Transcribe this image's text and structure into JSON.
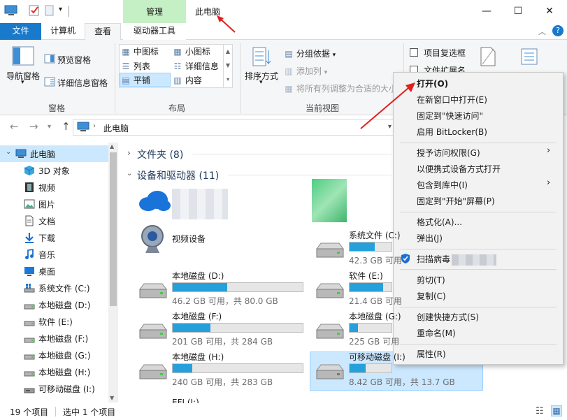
{
  "window": {
    "title": "此电脑",
    "context_tab": "管理",
    "controls": {
      "minimize": "—",
      "maximize": "☐",
      "close": "✕"
    }
  },
  "tabs": [
    {
      "label": "文件"
    },
    {
      "label": "计算机"
    },
    {
      "label": "查看"
    },
    {
      "label": "驱动器工具"
    }
  ],
  "ribbon": {
    "pane_group": {
      "label": "窗格",
      "nav_pane": "导航窗格",
      "preview_pane": "预览窗格",
      "details_pane": "详细信息窗格"
    },
    "layout_group": {
      "label": "布局",
      "items": [
        "中图标",
        "小图标",
        "列表",
        "详细信息",
        "平铺",
        "内容"
      ],
      "selected": "平铺"
    },
    "view_group": {
      "label": "当前视图",
      "sort": "排序方式",
      "group_by": "分组依据",
      "add_column": "添加列",
      "fit_columns": "将所有列调整为合适的大小"
    },
    "show_group": {
      "item_checkbox": "项目复选框",
      "file_ext": "文件扩展名"
    }
  },
  "address": {
    "path": "此电脑"
  },
  "nav": {
    "items": [
      {
        "label": "此电脑",
        "icon": "pc-icon"
      },
      {
        "label": "3D 对象",
        "icon": "cube-icon"
      },
      {
        "label": "视频",
        "icon": "film-icon"
      },
      {
        "label": "图片",
        "icon": "image-icon"
      },
      {
        "label": "文档",
        "icon": "document-icon"
      },
      {
        "label": "下载",
        "icon": "download-icon"
      },
      {
        "label": "音乐",
        "icon": "music-icon"
      },
      {
        "label": "桌面",
        "icon": "desktop-icon"
      },
      {
        "label": "系统文件 (C:)",
        "icon": "system-drive-icon"
      },
      {
        "label": "本地磁盘 (D:)",
        "icon": "drive-icon"
      },
      {
        "label": "软件 (E:)",
        "icon": "drive-icon"
      },
      {
        "label": "本地磁盘 (F:)",
        "icon": "drive-icon"
      },
      {
        "label": "本地磁盘 (G:)",
        "icon": "drive-icon"
      },
      {
        "label": "本地磁盘 (H:)",
        "icon": "drive-icon"
      },
      {
        "label": "可移动磁盘 (I:)",
        "icon": "usb-drive-icon"
      }
    ]
  },
  "content": {
    "folders_header": "文件夹 (8)",
    "devices_header": "设备和驱动器 (11)",
    "video_device": "视频设备",
    "drives_left": [
      {
        "name": "本地磁盘 (D:)",
        "caption": "46.2 GB 可用，共 80.0 GB",
        "used_pct": 42
      },
      {
        "name": "本地磁盘 (F:)",
        "caption": "201 GB 可用，共 284 GB",
        "used_pct": 29
      },
      {
        "name": "本地磁盘 (H:)",
        "caption": "240 GB 可用，共 283 GB",
        "used_pct": 15
      }
    ],
    "drives_right": [
      {
        "name": "系统文件 (C:)",
        "caption": "42.3 GB 可用",
        "used_pct": 60
      },
      {
        "name": "软件 (E:)",
        "caption": "21.4 GB 可用",
        "used_pct": 80
      },
      {
        "name": "本地磁盘 (G:)",
        "caption": "225 GB 可用",
        "used_pct": 20
      },
      {
        "name": "可移动磁盘 (I:)",
        "caption": "8.42 GB 可用，共 13.7 GB",
        "used_pct": 39
      }
    ],
    "partial_item": "EFI (J:)"
  },
  "status": {
    "count": "19 个项目",
    "selected": "选中 1 个项目"
  },
  "context_menu": {
    "open": "打开(O)",
    "open_new_window": "在新窗口中打开(E)",
    "pin_quick_access": "固定到\"快速访问\"",
    "bitlocker": "启用 BitLocker(B)",
    "grant_access": "授予访问权限(G)",
    "open_portable": "以便携式设备方式打开",
    "include_library": "包含到库中(I)",
    "pin_start": "固定到\"开始\"屏幕(P)",
    "format": "格式化(A)...",
    "eject": "弹出(J)",
    "scan_virus": "扫描病毒",
    "cut": "剪切(T)",
    "copy": "复制(C)",
    "create_shortcut": "创建快捷方式(S)",
    "rename": "重命名(M)",
    "properties": "属性(R)"
  },
  "colors": {
    "accent": "#1979ca",
    "manage_band": "#c5f0c5",
    "selection": "#cce8ff",
    "bar_fill": "#26a0da",
    "annotation_arrow": "#e02020"
  }
}
